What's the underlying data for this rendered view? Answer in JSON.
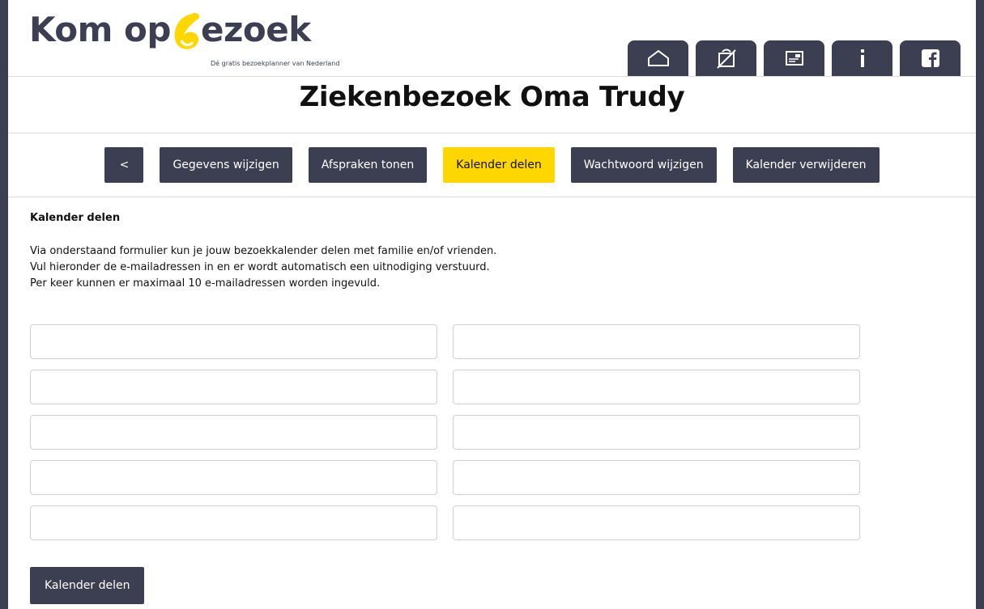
{
  "brand": {
    "logo_part1": "Kom op ",
    "logo_part2": "ezoek",
    "tagline": "Dé gratis bezoekplanner van Nederland",
    "accent_color": "#ffd700",
    "dark_color": "#3c3f51"
  },
  "topnav": [
    {
      "icon": "home-icon"
    },
    {
      "icon": "calendar-edit-icon"
    },
    {
      "icon": "contact-card-icon"
    },
    {
      "icon": "info-icon"
    },
    {
      "icon": "facebook-icon"
    }
  ],
  "page_title": "Ziekenbezoek Oma Trudy",
  "subnav": {
    "back": "<",
    "edit_details": "Gegevens wijzigen",
    "show_appointments": "Afspraken tonen",
    "share_calendar": "Kalender delen",
    "change_password": "Wachtwoord wijzigen",
    "delete_calendar": "Kalender verwijderen"
  },
  "share_form": {
    "title": "Kalender delen",
    "intro_line1": "Via onderstaand formulier kun je jouw bezoekkalender delen met familie en/of vrienden.",
    "intro_line2": "Vul hieronder de e-mailadressen in en er wordt automatisch een uitnodiging verstuurd.",
    "intro_line3": "Per keer kunnen er maximaal 10 e-mailadressen worden ingevuld.",
    "email_values": [
      "",
      "",
      "",
      "",
      "",
      "",
      "",
      "",
      "",
      ""
    ],
    "submit_label": "Kalender delen"
  }
}
